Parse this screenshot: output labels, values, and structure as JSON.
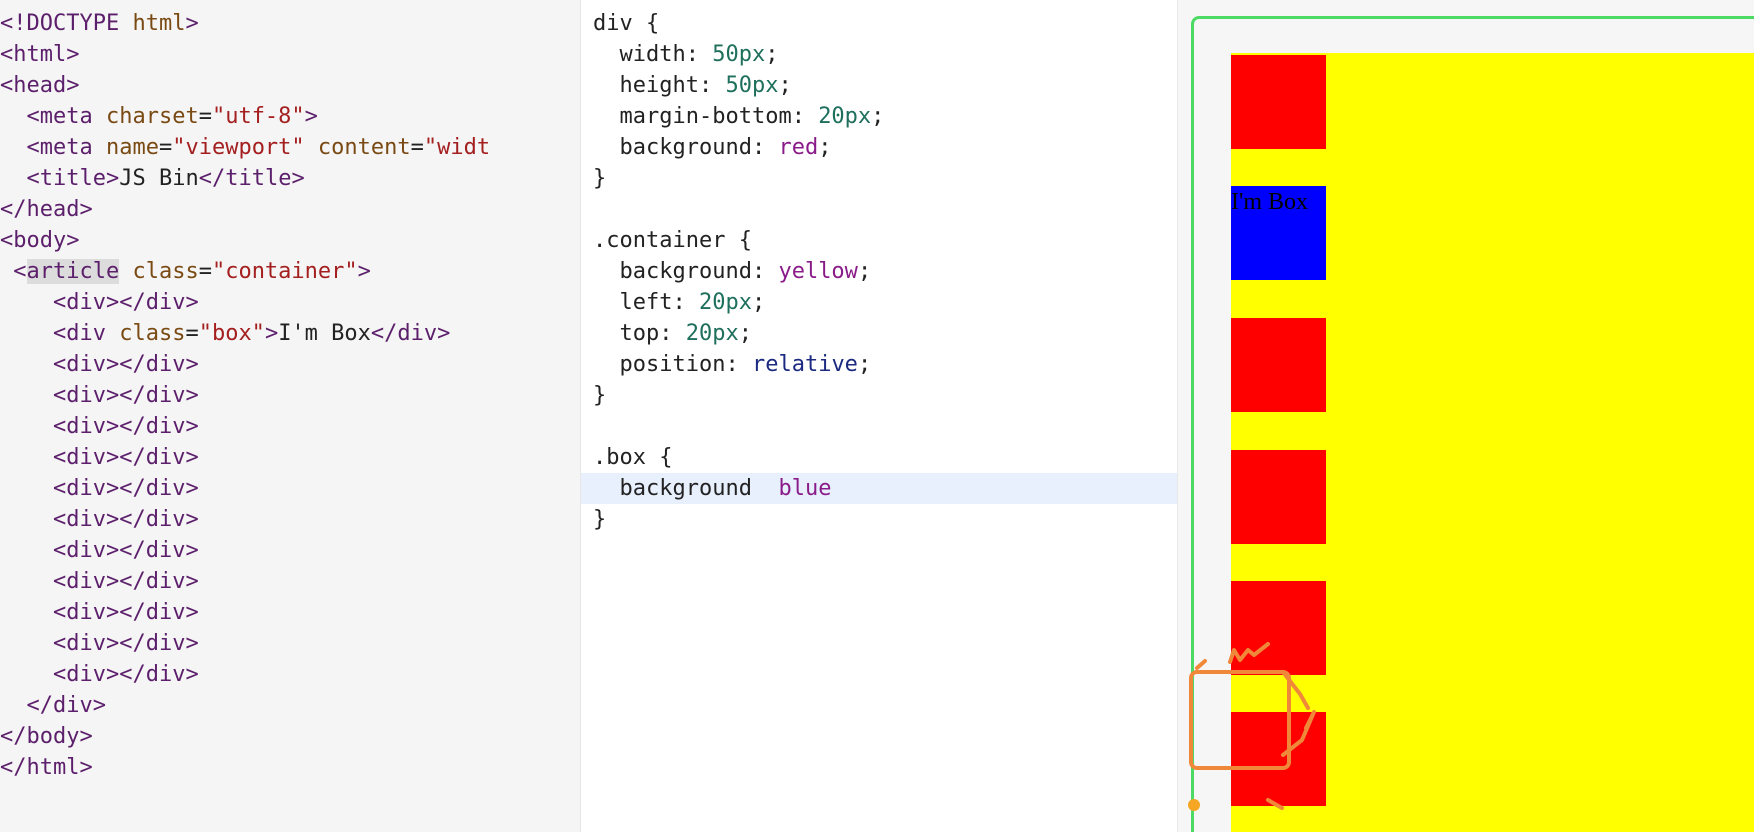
{
  "html_panel": {
    "lines": [
      "<!DOCTYPE html>",
      "<html>",
      "<head>",
      "  <meta charset=\"utf-8\">",
      "  <meta name=\"viewport\" content=\"widt",
      "  <title>JS Bin</title>",
      "</head>",
      "<body>",
      " <article class=\"container\">",
      "    <div></div>",
      "    <div class=\"box\">I'm Box</div>",
      "    <div></div>",
      "    <div></div>",
      "    <div></div>",
      "    <div></div>",
      "    <div></div>",
      "    <div></div>",
      "    <div></div>",
      "    <div></div>",
      "    <div></div>",
      "    <div></div>",
      "    <div></div>",
      "  </div>",
      "</body>",
      "</html>"
    ]
  },
  "css_panel": {
    "lines": [
      "div {",
      "  width: 50px;",
      "  height: 50px;",
      "  margin-bottom: 20px;",
      "  background: red;",
      "}",
      "",
      ".container {",
      "  background: yellow;",
      "  left: 20px;",
      "  top: 20px;",
      "  position: relative;",
      "}",
      "",
      ".box {",
      "  background: blue;",
      "}"
    ],
    "active_line_index": 15
  },
  "output": {
    "box_text": "I'm Box",
    "colors": {
      "frame": "#4cd964",
      "container": "#ffff00",
      "div": "#ff0000",
      "box": "#0000ff"
    }
  }
}
